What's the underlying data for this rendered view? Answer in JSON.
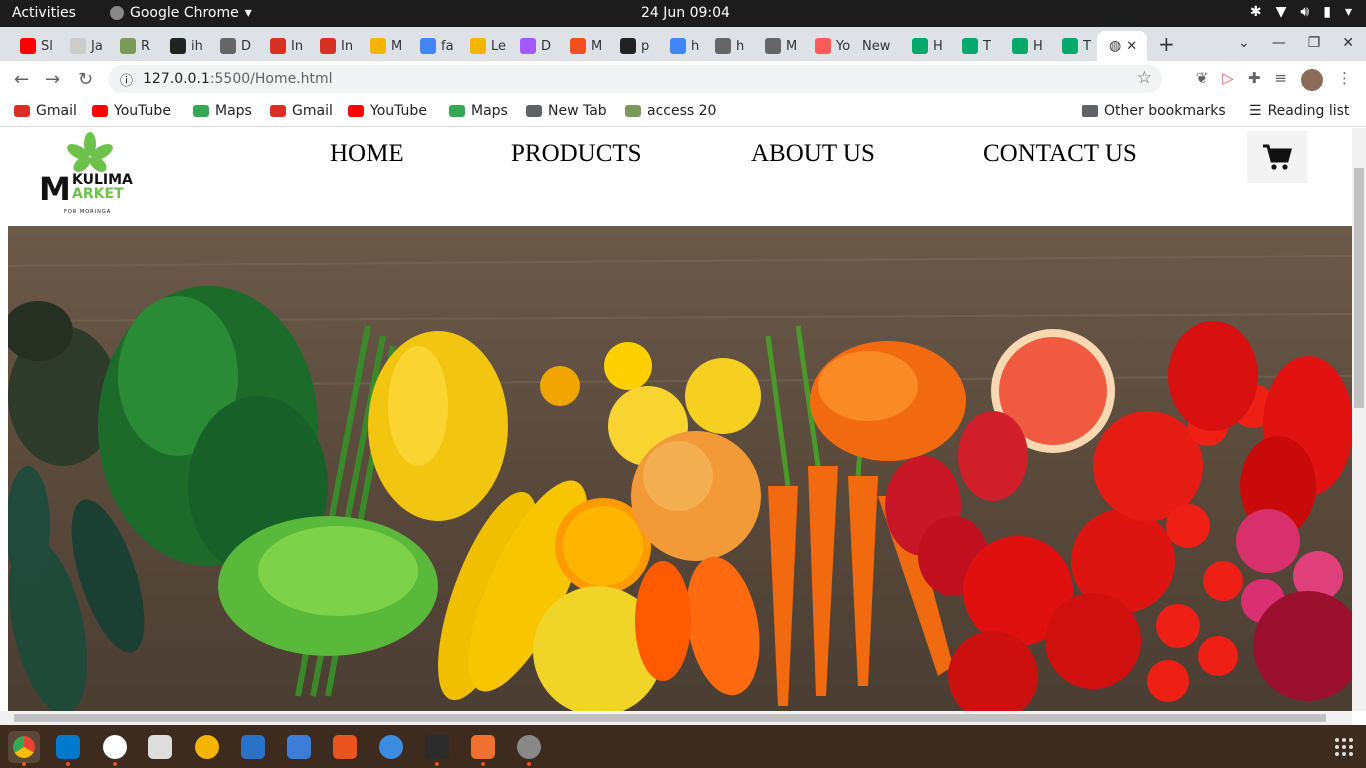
{
  "system": {
    "activities": "Activities",
    "app_name": "Google Chrome",
    "clock": "24 Jun  09:04"
  },
  "tabs": [
    {
      "label": "Sl",
      "color": "#ff0000"
    },
    {
      "label": "Ja",
      "color": "#cccccc"
    },
    {
      "label": "R",
      "color": "#7a9a5a"
    },
    {
      "label": "ih",
      "color": "#222222"
    },
    {
      "label": "D",
      "color": "#666666"
    },
    {
      "label": "In",
      "color": "#d93025"
    },
    {
      "label": "In",
      "color": "#d93025"
    },
    {
      "label": "M",
      "color": "#f4b400"
    },
    {
      "label": "fa",
      "color": "#4285f4"
    },
    {
      "label": "Le",
      "color": "#f4b400"
    },
    {
      "label": "D",
      "color": "#a259ff"
    },
    {
      "label": "M",
      "color": "#f24e1e"
    },
    {
      "label": "p",
      "color": "#222222"
    },
    {
      "label": "h",
      "color": "#4285f4"
    },
    {
      "label": "h",
      "color": "#666666"
    },
    {
      "label": "M",
      "color": "#666666"
    },
    {
      "label": "Yo",
      "color": "#ff5a5a"
    },
    {
      "label": "New",
      "color": ""
    },
    {
      "label": "H",
      "color": "#04aa6d"
    },
    {
      "label": "T",
      "color": "#04aa6d"
    },
    {
      "label": "H",
      "color": "#04aa6d"
    },
    {
      "label": "T",
      "color": "#04aa6d"
    }
  ],
  "active_tab": {
    "label": "",
    "close": "✕"
  },
  "toolbar": {
    "url_host": "127.0.0.1",
    "url_path": ":5500/Home.html"
  },
  "bookmarks": [
    {
      "label": "Gmail",
      "color": "#d93025"
    },
    {
      "label": "YouTube",
      "color": "#ff0000"
    },
    {
      "label": "Maps",
      "color": "#34a853"
    },
    {
      "label": "Gmail",
      "color": "#d93025"
    },
    {
      "label": "YouTube",
      "color": "#ff0000"
    },
    {
      "label": "Maps",
      "color": "#34a853"
    },
    {
      "label": "New Tab",
      "color": "#5f6368"
    },
    {
      "label": "access 20",
      "color": "#7a9a5a"
    }
  ],
  "bookmarks_right": {
    "other": "Other bookmarks",
    "reading": "Reading list"
  },
  "site": {
    "logo": {
      "line1": "KULIMA",
      "line2": "ARKET",
      "big_letter": "M",
      "tagline": "FOR MORINGA"
    },
    "nav": [
      "HOME",
      "PRODUCTS",
      "ABOUT US",
      "CONTACT US"
    ]
  },
  "colors": {
    "brand_green": "#6cc24a",
    "dark": "#1c1c1c",
    "accent": "#e95420"
  }
}
